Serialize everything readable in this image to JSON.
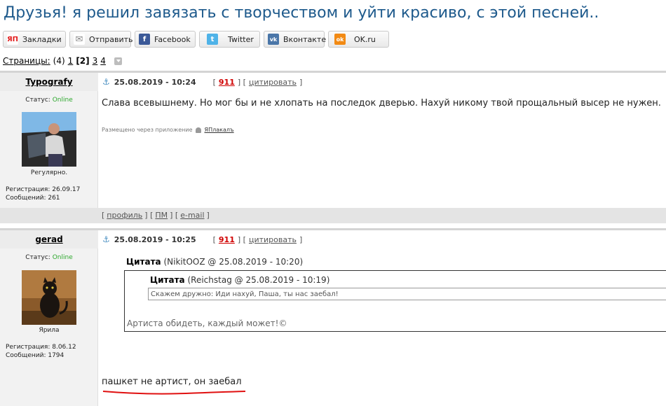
{
  "topic": {
    "title": "Друзья! я решил завязать с творчеством и уйти красиво, с этой песней.."
  },
  "share": [
    {
      "label": "Закладки",
      "icon": "yaplakal-icon",
      "icon_text": "ЯП",
      "color": "#e21e1e"
    },
    {
      "label": "Отправить",
      "icon": "envelope-icon",
      "icon_text": "✉",
      "color": "#888888"
    },
    {
      "label": "Facebook",
      "icon": "facebook-icon",
      "icon_text": "f",
      "color": "#3b5998"
    },
    {
      "label": "Twitter",
      "icon": "twitter-icon",
      "icon_text": "t",
      "color": "#4fb3e8"
    },
    {
      "label": "Вконтакте",
      "icon": "vk-icon",
      "icon_text": "vk",
      "color": "#4a76a8"
    },
    {
      "label": "OK.ru",
      "icon": "odnoklassniki-icon",
      "icon_text": "ok",
      "color": "#f28a14"
    }
  ],
  "pages": {
    "label": "Страницы:",
    "count": "(4)",
    "p1": "1",
    "current": "[2]",
    "p3": "3",
    "p4": "4"
  },
  "posts": [
    {
      "nick": "Typografy",
      "date": "25.08.2019 - 10:24",
      "rating": "911",
      "cite_label": "цитировать",
      "status_label": "Статус:",
      "status": "Online",
      "user_title": "Регулярно.",
      "reg": "Регистрация: 26.09.17",
      "msgs": "Сообщений: 261",
      "text": "Слава всевышнему. Но мог бы и не хлопать на последок дверью. Нахуй никому твой прощальный высер не нужен.",
      "via_label": "Размещено через приложение",
      "via_app": "ЯПлакалъ"
    },
    {
      "nick": "gerad",
      "date": "25.08.2019 - 10:25",
      "rating": "911",
      "cite_label": "цитировать",
      "status_label": "Статус:",
      "status": "Online",
      "user_title": "Ярила",
      "reg": "Регистрация: 8.06.12",
      "msgs": "Сообщений: 1794",
      "quote_label": "Цитата",
      "quote_author": "(NikitOOZ @ 25.08.2019 - 10:20)",
      "inner_quote_label": "Цитата",
      "inner_quote_author": "(Reichstag @ 25.08.2019 - 10:19)",
      "inner_quote_text": "Скажем дружно: Иди нахуй, Паша, ты нас заебал!",
      "quote_text": "Артиста обидеть, каждый может!©",
      "text": "пашкет не артист, он заебал"
    }
  ],
  "footer": {
    "profile": "профиль",
    "pm": "ПМ",
    "email": "e-mail"
  },
  "colors": {
    "title": "#1e5a8c",
    "online": "#2ea82e",
    "rating": "#d00000",
    "highlight": "#e01010"
  }
}
